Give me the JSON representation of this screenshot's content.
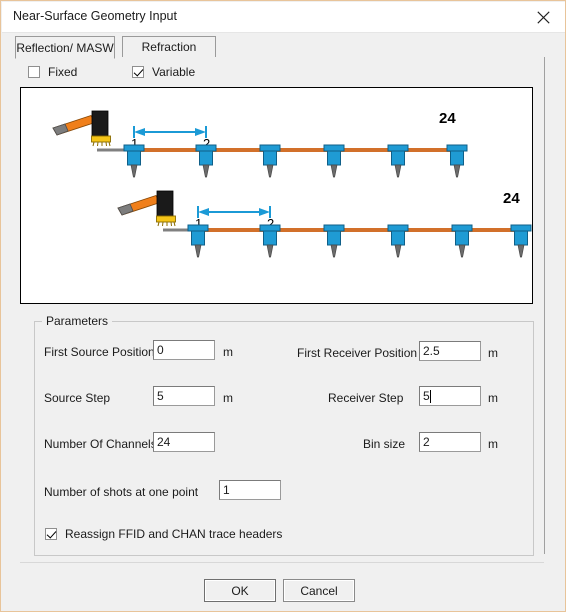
{
  "window": {
    "title": "Near-Surface Geometry Input",
    "close_icon": "close-icon"
  },
  "tabs": [
    {
      "label": "Reflection/ MASW",
      "active": true
    },
    {
      "label": "Refraction",
      "active": false
    }
  ],
  "mode_checkboxes": [
    {
      "label": "Fixed",
      "checked": false
    },
    {
      "label": "Variable",
      "checked": true
    }
  ],
  "diagram": {
    "rows": [
      {
        "source_label": "hammer-source",
        "receiver_labels": {
          "first": "1",
          "second": "2",
          "last": "24"
        },
        "receiver_count_shown": 6
      },
      {
        "source_label": "hammer-source",
        "receiver_labels": {
          "first": "1",
          "second": "2",
          "last": "24"
        },
        "receiver_count_shown": 6
      }
    ],
    "colors": {
      "cable": "#d2702a",
      "geophone": "#1f9bd4",
      "geophone_dark": "#0f6fa0",
      "spike": "#6b6b6b",
      "hammer_handle": "#f07f1a",
      "hammer_head": "#1a1a1a",
      "plate": "#f5c518",
      "arrow": "#1b9ad6",
      "lead": "#808080"
    }
  },
  "parameters": {
    "group_label": "Parameters",
    "fields": [
      {
        "label": "First Source Position",
        "value": "0",
        "unit": "m",
        "focused": false
      },
      {
        "label": "First Receiver Position",
        "value": "2.5",
        "unit": "m",
        "focused": false
      },
      {
        "label": "Source Step",
        "value": "5",
        "unit": "m",
        "focused": false
      },
      {
        "label": "Receiver Step",
        "value": "5",
        "unit": "m",
        "focused": true
      },
      {
        "label": "Number Of Channels",
        "value": "24",
        "unit": "",
        "focused": false
      },
      {
        "label": "Bin size",
        "value": "2",
        "unit": "m",
        "focused": false
      },
      {
        "label": "Number of shots at one point",
        "value": "1",
        "unit": "",
        "focused": false
      }
    ],
    "reassign_checkbox": {
      "label": "Reassign FFID and CHAN trace headers",
      "checked": true
    }
  },
  "buttons": {
    "ok": "OK",
    "cancel": "Cancel"
  }
}
